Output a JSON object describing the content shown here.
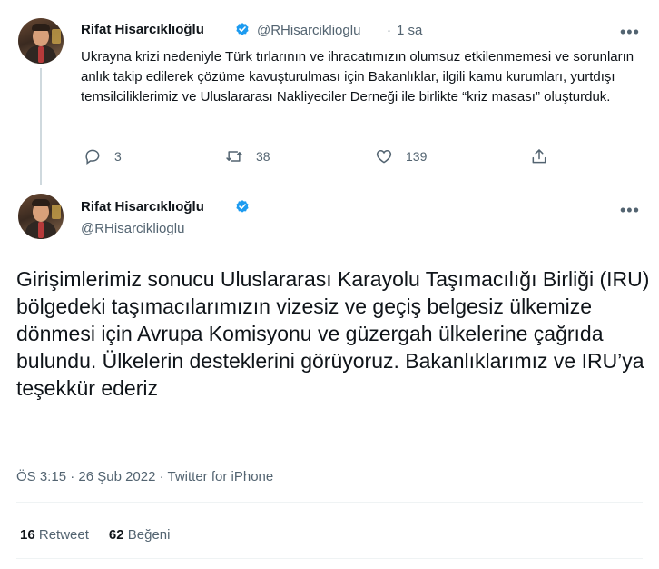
{
  "colors": {
    "text": "#0f1419",
    "muted": "#536471",
    "verified": "#1d9bf0",
    "line": "#cfd9de"
  },
  "reply_tweet": {
    "author_name": "Rifat Hisarcıklıoğlu",
    "handle": "@RHisarciklioglu",
    "separator": "·",
    "time": "1 sa",
    "text": "Ukrayna krizi nedeniyle Türk tırlarının ve ihracatımızın olumsuz etkilenmemesi ve sorunların anlık takip edilerek çözüme kavuşturulması için Bakanlıklar, ilgili kamu kurumları, yurtdışı temsilciliklerimiz ve Uluslararası Nakliyeciler Derneği ile birlikte “kriz masası” oluşturduk.",
    "actions": {
      "reply_count": "3",
      "retweet_count": "38",
      "like_count": "139"
    }
  },
  "main_tweet": {
    "author_name": "Rifat Hisarcıklıoğlu",
    "handle": "@RHisarciklioglu",
    "text": "Girişimlerimiz sonucu Uluslararası Karayolu Taşımacılığı Birliği (IRU) bölgedeki taşımacılarımızın vizesiz ve geçiş belgesiz ülkemize dönmesi için Avrupa Komisyonu ve güzergah ülkelerine çağrıda bulundu. Ülkelerin desteklerini görüyoruz. Bakanlıklarımız ve IRU’ya teşekkür ederiz",
    "meta": "ÖS 3:15 · 26 Şub 2022 · Twitter for iPhone",
    "stats": {
      "retweet_count": "16",
      "retweet_label": "Retweet",
      "like_count": "62",
      "like_label": "Beğeni"
    }
  },
  "icons": [
    "verified-badge-icon",
    "more-icon",
    "reply-icon",
    "retweet-icon",
    "like-icon",
    "share-icon"
  ]
}
